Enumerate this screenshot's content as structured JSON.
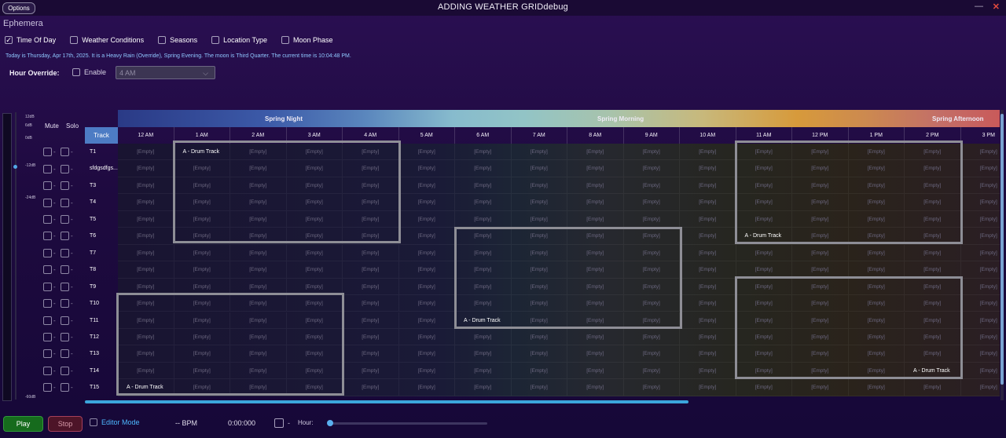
{
  "window": {
    "options_label": "Options",
    "title": "ADDING WEATHER GRIDdebug",
    "minimize_glyph": "—",
    "close_glyph": "✕"
  },
  "app_name": "Ephemera",
  "filters": [
    {
      "label": "Time Of Day",
      "checked": true
    },
    {
      "label": "Weather Conditions",
      "checked": false
    },
    {
      "label": "Seasons",
      "checked": false
    },
    {
      "label": "Location Type",
      "checked": false
    },
    {
      "label": "Moon Phase",
      "checked": false
    }
  ],
  "status_line": "Today is Thursday, Apr 17th, 2025. It is a Heavy Rain (Override), Spring Evening. The moon is Third Quarter. The current time is 10:04:48 PM.",
  "hour_override": {
    "label": "Hour Override:",
    "enable_label": "Enable",
    "enabled": false,
    "selected": "4 AM",
    "chevron_glyph": "⌵"
  },
  "meter": {
    "labels": [
      "12dB",
      "6dB",
      "0dB",
      "-12dB",
      "-24dB",
      "-60dB"
    ],
    "level_db": -12
  },
  "mixer_headers": {
    "mute": "Mute",
    "solo": "Solo",
    "dot": "-"
  },
  "grid": {
    "track_header": "Track",
    "seasons": [
      "Spring Night",
      "Spring Morning",
      "Spring Afternoon"
    ],
    "hours": [
      "12 AM",
      "1 AM",
      "2 AM",
      "3 AM",
      "4 AM",
      "5 AM",
      "6 AM",
      "7 AM",
      "8 AM",
      "9 AM",
      "10 AM",
      "11 AM",
      "12 PM",
      "1 PM",
      "2 PM",
      "3 PM"
    ],
    "tracks": [
      "T1",
      "sfdgsdfgs...",
      "T3",
      "T4",
      "T5",
      "T6",
      "T7",
      "T8",
      "T9",
      "T10",
      "T11",
      "T12",
      "T13",
      "T14",
      "T15"
    ],
    "empty_label": "[Empty]",
    "filled_label": "A - Drum Track",
    "filled_cells": [
      {
        "row": 0,
        "col": 1
      },
      {
        "row": 5,
        "col": 11
      },
      {
        "row": 10,
        "col": 6
      },
      {
        "row": 13,
        "col": 14
      },
      {
        "row": 14,
        "col": 0
      }
    ]
  },
  "transport": {
    "play_label": "Play",
    "stop_label": "Stop",
    "editor_mode_label": "Editor Mode",
    "editor_mode": false,
    "bpm": "-- BPM",
    "time": "0:00:000",
    "extra_label": "-",
    "hour_label": "Hour:",
    "hour_value": 0
  },
  "colors": {
    "accent": "#3ba6dc",
    "play": "#166b1d",
    "stop": "#4d1428",
    "editor_mode": "#4db8ff"
  }
}
